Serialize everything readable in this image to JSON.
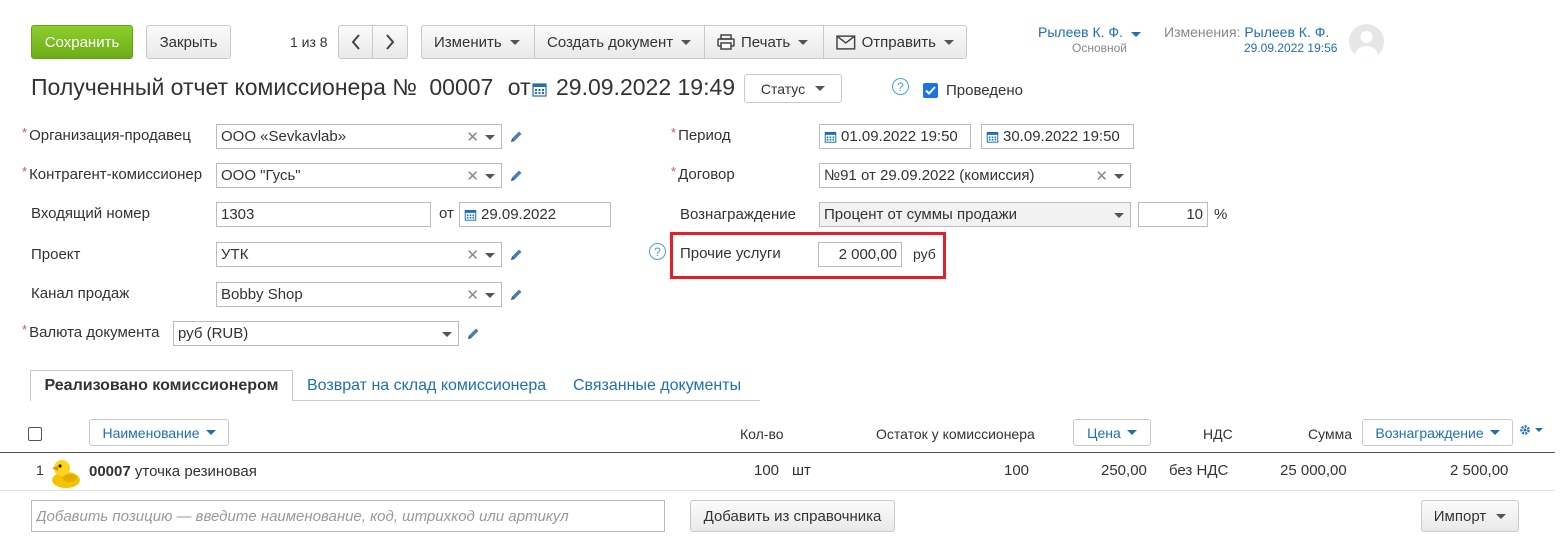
{
  "toolbar": {
    "save_label": "Сохранить",
    "close_label": "Закрыть",
    "pager": "1 из 8",
    "edit_label": "Изменить",
    "create_doc_label": "Создать документ",
    "print_label": "Печать",
    "send_label": "Отправить"
  },
  "user": {
    "name": "Рылеев К. Ф.",
    "role": "Основной",
    "changes_label": "Изменения:",
    "changes_user": "Рылеев К. Ф.",
    "changes_time": "29.09.2022 19:56"
  },
  "doc": {
    "title": "Полученный отчет комиссионера №",
    "number": "00007",
    "from_label": "от",
    "datetime": "29.09.2022 19:49",
    "status_label": "Статус",
    "posted_label": "Проведено",
    "posted": true
  },
  "form": {
    "org_label": "Организация-продавец",
    "org_value": "ООО «Sevkavlab»",
    "contractor_label": "Контрагент-комиссионер",
    "contractor_value": "ООО \"Гусь\"",
    "incoming_label": "Входящий номер",
    "incoming_value": "1303",
    "incoming_from": "от",
    "incoming_date": "29.09.2022",
    "project_label": "Проект",
    "project_value": "УТК",
    "channel_label": "Канал продаж",
    "channel_value": "Bobby Shop",
    "currency_label": "Валюта документа",
    "currency_value": "руб (RUB)",
    "period_label": "Период",
    "period_from": "01.09.2022 19:50",
    "period_to": "30.09.2022 19:50",
    "contract_label": "Договор",
    "contract_value": "№91 от 29.09.2022 (комиссия)",
    "reward_label": "Вознаграждение",
    "reward_type": "Процент от суммы продажи",
    "reward_percent": "10",
    "reward_unit": "%",
    "other_label": "Прочие услуги",
    "other_value": "2 000,00",
    "other_unit": "руб"
  },
  "tabs": [
    "Реализовано комиссионером",
    "Возврат на склад комиссионера",
    "Связанные документы"
  ],
  "table": {
    "col_name": "Наименование",
    "col_qty": "Кол-во",
    "col_rest": "Остаток у комиссионера",
    "col_price": "Цена",
    "col_vat": "НДС",
    "col_sum": "Сумма",
    "col_reward": "Вознаграждение",
    "rows": [
      {
        "n": "1",
        "code": "00007",
        "name": "уточка резиновая",
        "qty": "100",
        "unit": "шт",
        "rest": "100",
        "price": "250,00",
        "vat": "без НДС",
        "sum": "25 000,00",
        "reward": "2 500,00"
      }
    ]
  },
  "footer": {
    "add_placeholder": "Добавить позицию — введите наименование, код, штрихкод или артикул",
    "add_from_catalog": "Добавить из справочника",
    "import_label": "Импорт"
  },
  "colors": {
    "accent": "#1f6fb4",
    "save": "#7cbf22",
    "highlight": "#e0202a"
  }
}
